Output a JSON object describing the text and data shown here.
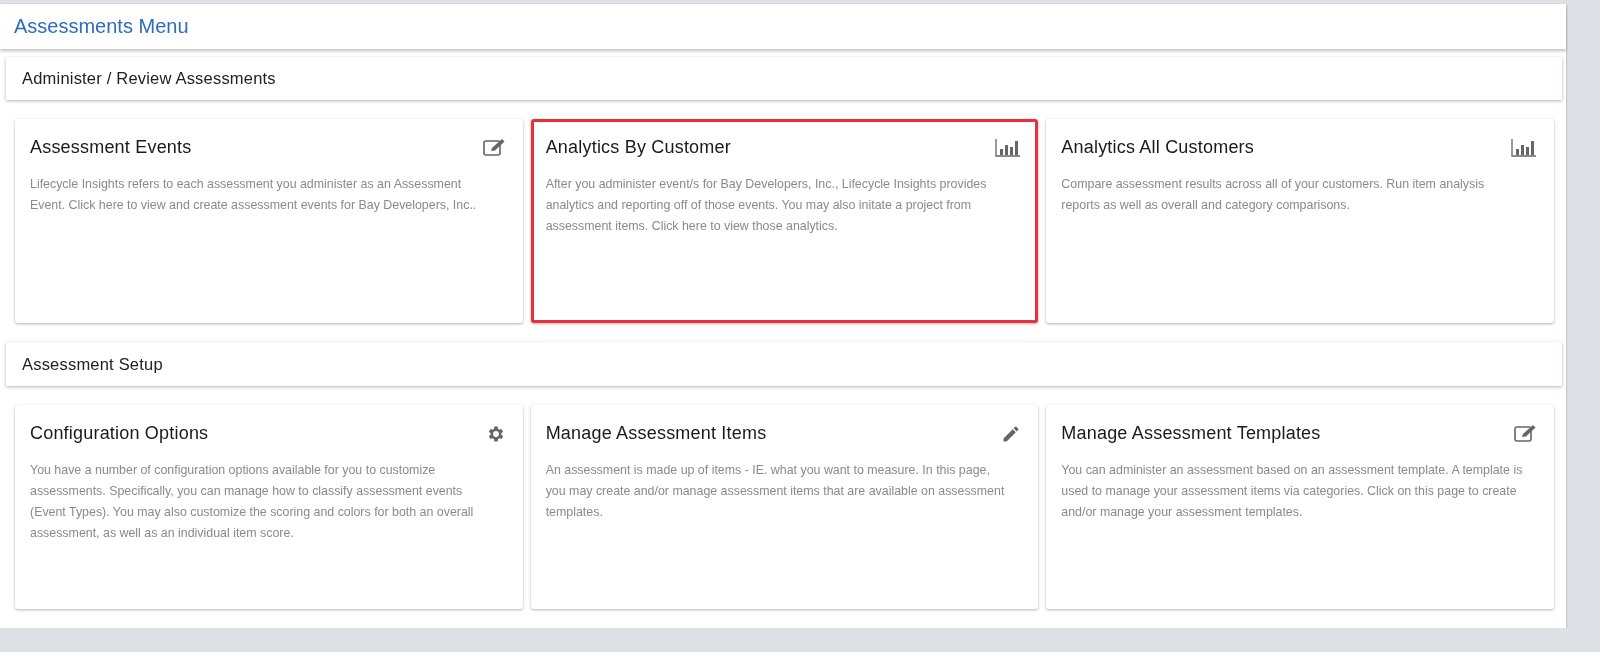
{
  "page_title": "Assessments Menu",
  "sections": [
    {
      "title": "Administer / Review Assessments",
      "cards": [
        {
          "title": "Assessment Events",
          "kind": "edit",
          "highlighted": false,
          "text": "Lifecycle Insights refers to each assessment you administer as an Assessment Event. Click here to view and create assessment events for Bay Developers, Inc.."
        },
        {
          "title": "Analytics By Customer",
          "kind": "chart",
          "highlighted": true,
          "text": "After you administer event/s for Bay Developers, Inc., Lifecycle Insights provides analytics and reporting off of those events. You may also initate a project from assessment items. Click here to view those analytics."
        },
        {
          "title": "Analytics All Customers",
          "kind": "chart",
          "highlighted": false,
          "text": "Compare assessment results across all of your customers. Run item analysis reports as well as overall and category comparisons."
        }
      ]
    },
    {
      "title": "Assessment Setup",
      "cards": [
        {
          "title": "Configuration Options",
          "kind": "gear",
          "highlighted": false,
          "text": "You have a number of configuration options available for you to customize assessments. Specifically, you can manage how to classify assessment events (Event Types). You may also customize the scoring and colors for both an overall assessment, as well as an individual item score."
        },
        {
          "title": "Manage Assessment Items",
          "kind": "pencil",
          "highlighted": false,
          "text": "An assessment is made up of items - IE. what you want to measure. In this page, you may create and/or manage assessment items that are available on assessment templates."
        },
        {
          "title": "Manage Assessment Templates",
          "kind": "edit",
          "highlighted": false,
          "text": "You can administer an assessment based on an assessment template. A template is used to manage your assessment items via categories. Click on this page to create and/or manage your assessment templates."
        }
      ]
    }
  ]
}
